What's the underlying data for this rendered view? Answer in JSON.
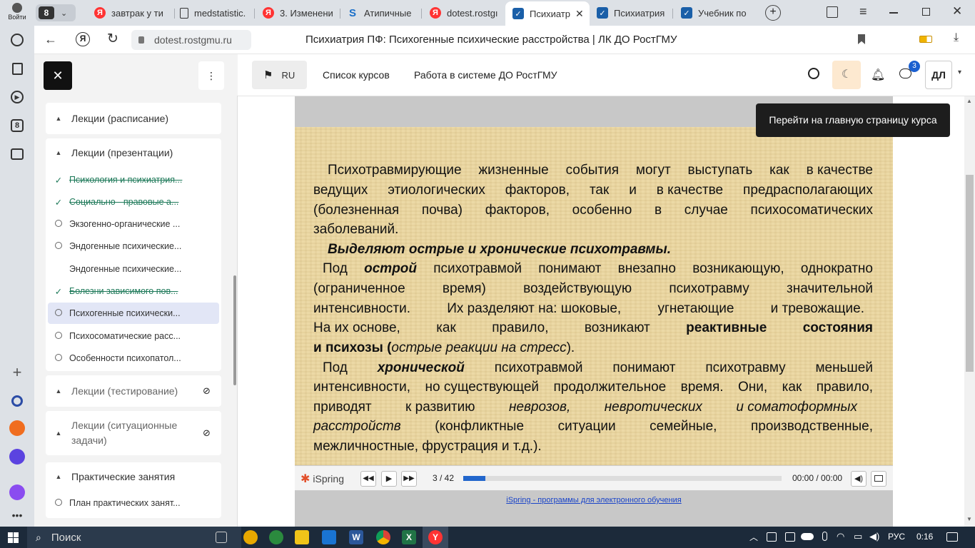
{
  "browser": {
    "profile_label": "Войти",
    "tab_count": "8",
    "tabs": [
      {
        "title": "завтрак у ти",
        "icon": "yandex-icon"
      },
      {
        "title": "medstatistic.",
        "icon": "page-icon"
      },
      {
        "title": "3. Изменени",
        "icon": "yandex-icon"
      },
      {
        "title": "Атипичные",
        "icon": "s-logo-icon"
      },
      {
        "title": "dotest.rostgı",
        "icon": "yandex-icon"
      },
      {
        "title": "Психиатр",
        "icon": "moodle-icon",
        "active": true
      },
      {
        "title": "Психиатрия",
        "icon": "moodle-icon"
      },
      {
        "title": "Учебник по",
        "icon": "moodle-icon"
      }
    ],
    "address": "dotest.rostgmu.ru",
    "page_title": "Психиатрия ПФ: Психогенные психические расстройства | ЛК ДО РостГМУ",
    "side_badge": "8"
  },
  "header": {
    "lang": "RU",
    "nav": [
      "Список курсов",
      "Работа в системе ДО РостГМУ"
    ],
    "notif_count": "3",
    "user_initials": "ДЛ"
  },
  "drawer": {
    "sections": [
      {
        "title": "Лекции (расписание)"
      },
      {
        "title": "Лекции (презентации)",
        "items": [
          {
            "label": "Психология и психиатрия...",
            "status": "done"
          },
          {
            "label": "Социально - правовые а...",
            "status": "done"
          },
          {
            "label": "Экзогенно-органические ...",
            "status": "todo"
          },
          {
            "label": "Эндогенные психические...",
            "status": "todo"
          },
          {
            "label": "Эндогенные психические...",
            "status": "none"
          },
          {
            "label": "Болезни зависимого пов...",
            "status": "done"
          },
          {
            "label": "Психогенные психически...",
            "status": "todo",
            "current": true
          },
          {
            "label": "Психосоматические расс...",
            "status": "todo"
          },
          {
            "label": "Особенности психопатол...",
            "status": "todo"
          }
        ]
      },
      {
        "title": "Лекции (тестирование)",
        "hidden": true
      },
      {
        "title_line1": "Лекции (ситуационные",
        "title_line2": "задачи)",
        "hidden": true
      },
      {
        "title": "Практические занятия",
        "items": [
          {
            "label": "План практических занят...",
            "status": "todo"
          }
        ]
      }
    ]
  },
  "goto_course_button": "Перейти на главную страницу курса",
  "slide": {
    "lines": [
      [
        "Психотравмирующие",
        "жизненные",
        "события",
        "могут",
        "выступать",
        "как",
        "в качестве"
      ],
      [
        "ведущих",
        "этиологических",
        "факторов,",
        "так",
        "и",
        "в качестве",
        "предрасполагающих"
      ],
      [
        "(болезненная",
        "почва)",
        "факторов,",
        "особенно",
        "в",
        "случае",
        "психосоматических"
      ],
      [
        "заболеваний."
      ],
      [
        "Выделяют острые и хронические психотравмы."
      ],
      [
        "Под",
        "острой",
        "психотравмой",
        "понимают",
        "внезапно",
        "возникающую,",
        "однократно"
      ],
      [
        "(ограниченное",
        "время)",
        "воздействующую",
        "психотравму",
        "значительной"
      ],
      [
        "интенсивности.",
        "Их разделяют на: шоковые,",
        "угнетающие",
        "и тревожащие."
      ],
      [
        "На их основе,",
        "как",
        "правило,",
        "возникают",
        "реактивные",
        "состояния"
      ],
      [
        "и психозы (",
        "острые реакции на стресс",
        "). "
      ],
      [
        "Под",
        "хронической",
        "психотравмой",
        "понимают",
        "психотравму",
        "меньшей"
      ],
      [
        "интенсивности,",
        "но существующей",
        "продолжительное",
        "время.",
        "Они,",
        "как",
        "правило,"
      ],
      [
        "приводят",
        "к развитию",
        "неврозов,",
        "невротических",
        "и соматоформных"
      ],
      [
        "расстройств",
        "(конфликтные",
        "ситуации",
        "семейные,",
        "производственные,"
      ],
      [
        "межличностные, фрустрация и т.д.)."
      ]
    ]
  },
  "player": {
    "brand": "iSpring",
    "slide_counter": "3 / 42",
    "time": "00:00 / 00:00",
    "progress": 0.07,
    "footer_link": "iSpring - программы для электронного обучения"
  },
  "taskbar": {
    "search": "Поиск",
    "lang": "РУС",
    "clock": "0:16"
  }
}
